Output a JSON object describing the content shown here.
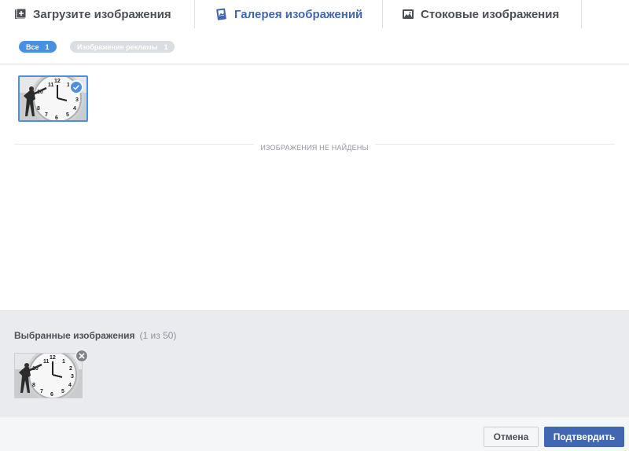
{
  "tabs": [
    {
      "label": "Загрузите изображения",
      "icon": "upload-image-icon"
    },
    {
      "label": "Галерея изображений",
      "icon": "image-gallery-icon",
      "active": true
    },
    {
      "label": "Стоковые изображения",
      "icon": "stock-image-icon"
    }
  ],
  "filters": {
    "all": {
      "label": "Все",
      "count": "1"
    },
    "ads": {
      "label": "Изображения рекламы",
      "count": "1"
    }
  },
  "gallery": {
    "empty_text": "ИЗОБРАЖЕНИЯ НЕ НАЙДЕНЫ",
    "thumbnail": "clock-man-photo"
  },
  "selected": {
    "title": "Выбранные изображения",
    "count_text": "(1 из 50)"
  },
  "footer": {
    "cancel_label": "Отмена",
    "confirm_label": "Подтвердить"
  },
  "colors": {
    "accent": "#4267b2",
    "pill_active": "#4a90e2",
    "pill_inactive": "#dadde1",
    "selected_bg": "#e9ebee"
  }
}
